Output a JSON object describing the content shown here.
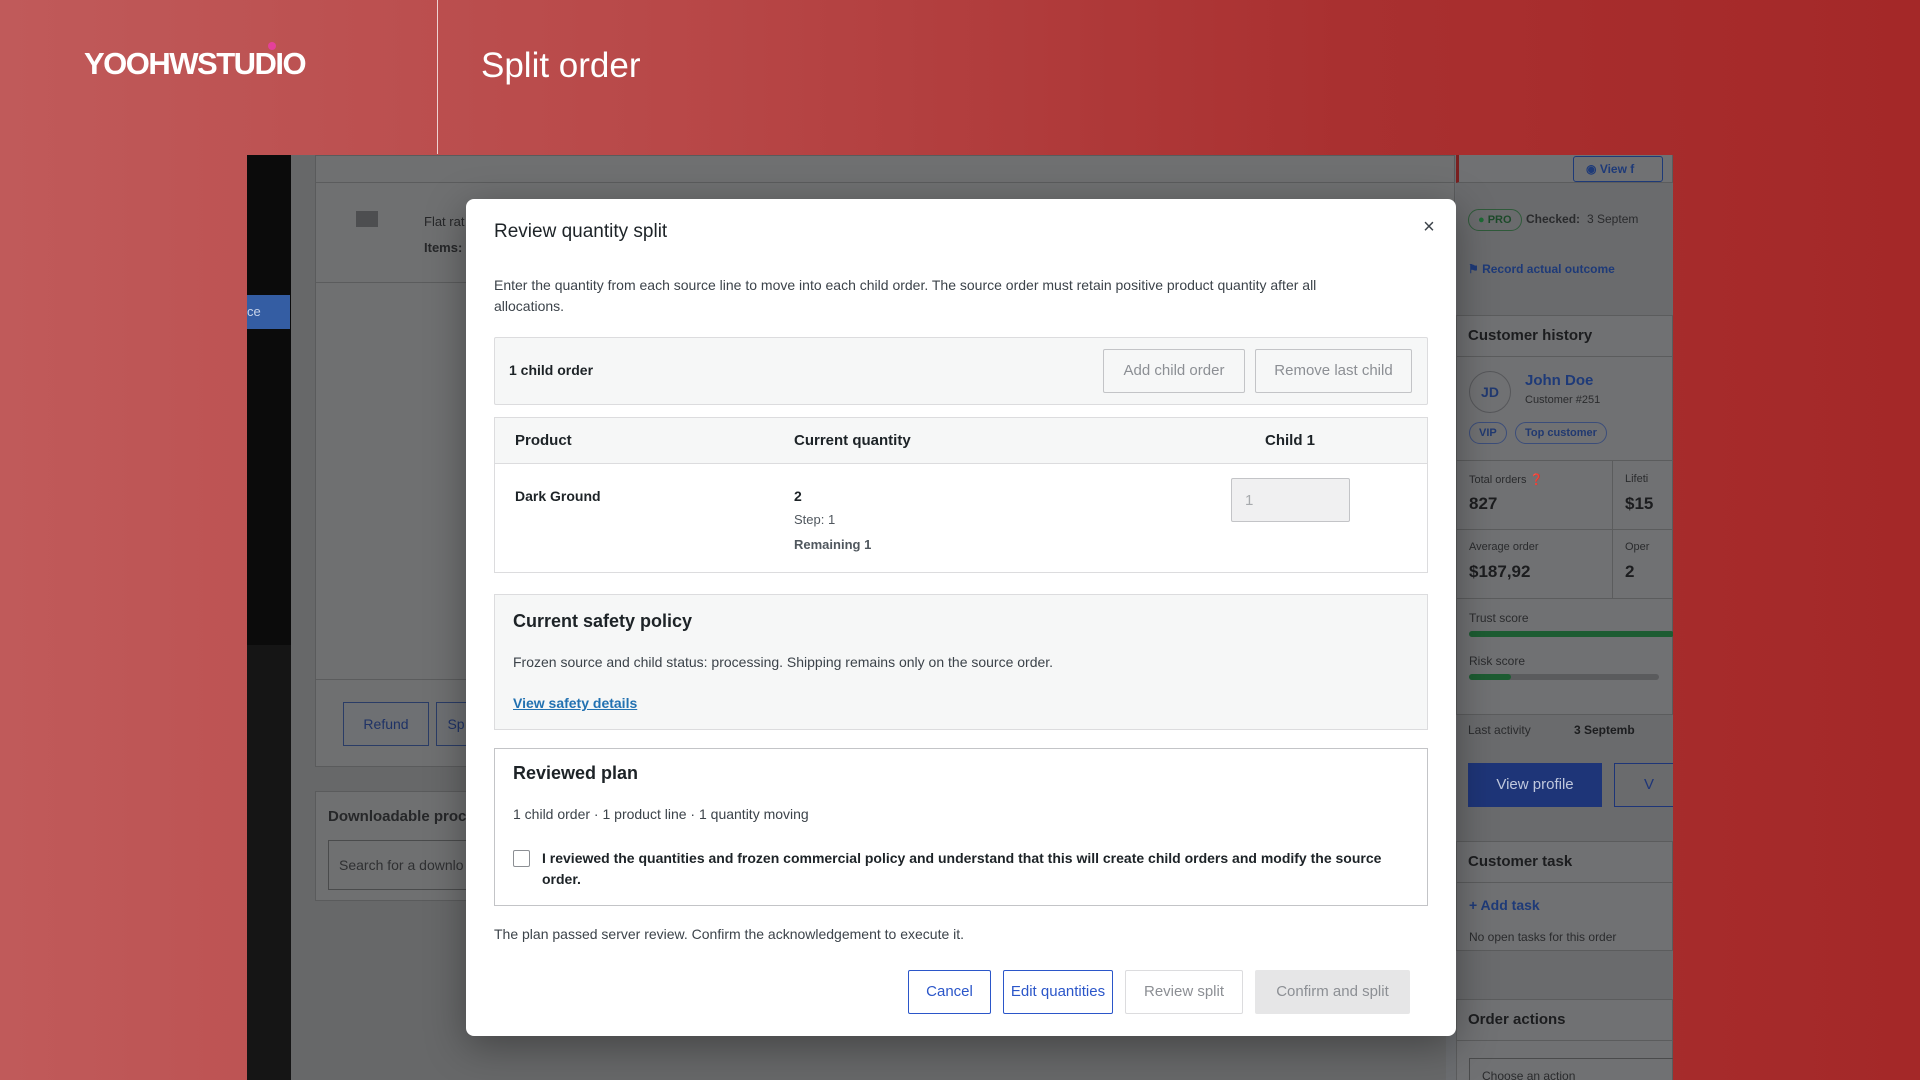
{
  "banner": {
    "brand": "YOOHWSTUDIO",
    "title": "Split order"
  },
  "background_page": {
    "sidebar_tab": "ce",
    "shipping_label": "Flat rat",
    "items_label": "Items:",
    "refund_button": "Refund",
    "split_button_partial": "Sp",
    "downloadable_title": "Downloadable proc",
    "download_search_placeholder": "Search for a downlo",
    "right_panel": {
      "view_link": "View f",
      "pro_badge": "PRO",
      "checked_label": "Checked:",
      "checked_value": "3 Septem",
      "record_outcome": "Record actual outcome",
      "customer_history_title": "Customer history",
      "avatar_initials": "JD",
      "customer_name": "John Doe",
      "customer_number": "Customer #251",
      "tags": [
        "VIP",
        "Top customer"
      ],
      "total_orders_label": "Total orders",
      "total_orders_value": "827",
      "lifetime_label": "Lifeti",
      "lifetime_value": "$15",
      "average_order_label": "Average order",
      "average_order_value": "$187,92",
      "open_label": "Oper",
      "open_value": "2",
      "trust_score_label": "Trust score",
      "trust_score_fraction": 1.0,
      "risk_score_label": "Risk score",
      "risk_score_fraction": 0.22,
      "last_activity_label": "Last activity",
      "last_activity_value": "3 Septemb",
      "view_profile_button": "View profile",
      "second_button_partial": "V",
      "customer_task_title": "Customer task",
      "add_task_link": "Add task",
      "no_tasks_text": "No open tasks for this order",
      "order_actions_title": "Order actions",
      "choose_action_placeholder": "Choose an action"
    }
  },
  "modal": {
    "title": "Review quantity split",
    "close_glyph": "×",
    "intro": "Enter the quantity from each source line to move into each child order. The source order must retain positive product quantity after all allocations.",
    "toolbar": {
      "child_count": "1 child order",
      "add_child_button": "Add child order",
      "remove_child_button": "Remove last child"
    },
    "table": {
      "columns": [
        "Product",
        "Current quantity",
        "Child 1"
      ],
      "rows": [
        {
          "product": "Dark Ground",
          "current_quantity": "2",
          "step": "Step: 1",
          "remaining": "Remaining 1",
          "child_1_value": "1"
        }
      ]
    },
    "policy": {
      "title": "Current safety policy",
      "text": "Frozen source and child status: processing. Shipping remains only on the source order.",
      "link": "View safety details"
    },
    "plan": {
      "title": "Reviewed plan",
      "summary": "1 child order · 1 product line · 1 quantity moving",
      "acknowledgement": "I reviewed the quantities and frozen commercial policy and understand that this will create child orders and modify the source order.",
      "checked": false
    },
    "review_note": "The plan passed server review. Confirm the acknowledgement to execute it.",
    "footer": {
      "cancel": "Cancel",
      "edit_quantities": "Edit quantities",
      "review_split": "Review split",
      "confirm_split": "Confirm and split"
    }
  },
  "colors": {
    "accent_blue": "#2b56c9",
    "link_blue": "#2271b1",
    "brand_dot": "#e5409a",
    "banner_red": "#a42828"
  }
}
